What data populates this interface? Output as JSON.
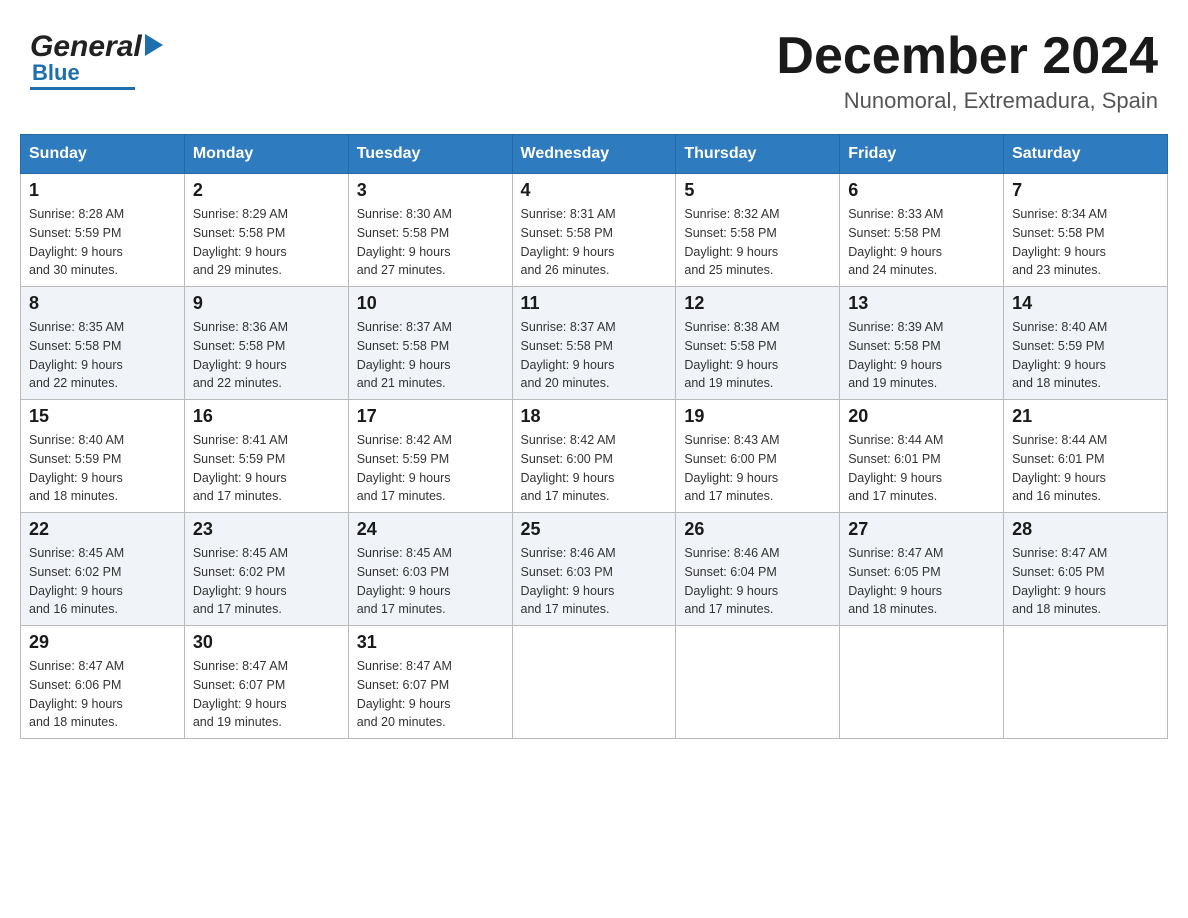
{
  "header": {
    "logo_general": "General",
    "logo_blue": "Blue",
    "month_title": "December 2024",
    "location": "Nunomoral, Extremadura, Spain"
  },
  "columns": [
    "Sunday",
    "Monday",
    "Tuesday",
    "Wednesday",
    "Thursday",
    "Friday",
    "Saturday"
  ],
  "weeks": [
    [
      {
        "day": "1",
        "sunrise": "Sunrise: 8:28 AM",
        "sunset": "Sunset: 5:59 PM",
        "daylight": "Daylight: 9 hours",
        "daylight2": "and 30 minutes."
      },
      {
        "day": "2",
        "sunrise": "Sunrise: 8:29 AM",
        "sunset": "Sunset: 5:58 PM",
        "daylight": "Daylight: 9 hours",
        "daylight2": "and 29 minutes."
      },
      {
        "day": "3",
        "sunrise": "Sunrise: 8:30 AM",
        "sunset": "Sunset: 5:58 PM",
        "daylight": "Daylight: 9 hours",
        "daylight2": "and 27 minutes."
      },
      {
        "day": "4",
        "sunrise": "Sunrise: 8:31 AM",
        "sunset": "Sunset: 5:58 PM",
        "daylight": "Daylight: 9 hours",
        "daylight2": "and 26 minutes."
      },
      {
        "day": "5",
        "sunrise": "Sunrise: 8:32 AM",
        "sunset": "Sunset: 5:58 PM",
        "daylight": "Daylight: 9 hours",
        "daylight2": "and 25 minutes."
      },
      {
        "day": "6",
        "sunrise": "Sunrise: 8:33 AM",
        "sunset": "Sunset: 5:58 PM",
        "daylight": "Daylight: 9 hours",
        "daylight2": "and 24 minutes."
      },
      {
        "day": "7",
        "sunrise": "Sunrise: 8:34 AM",
        "sunset": "Sunset: 5:58 PM",
        "daylight": "Daylight: 9 hours",
        "daylight2": "and 23 minutes."
      }
    ],
    [
      {
        "day": "8",
        "sunrise": "Sunrise: 8:35 AM",
        "sunset": "Sunset: 5:58 PM",
        "daylight": "Daylight: 9 hours",
        "daylight2": "and 22 minutes."
      },
      {
        "day": "9",
        "sunrise": "Sunrise: 8:36 AM",
        "sunset": "Sunset: 5:58 PM",
        "daylight": "Daylight: 9 hours",
        "daylight2": "and 22 minutes."
      },
      {
        "day": "10",
        "sunrise": "Sunrise: 8:37 AM",
        "sunset": "Sunset: 5:58 PM",
        "daylight": "Daylight: 9 hours",
        "daylight2": "and 21 minutes."
      },
      {
        "day": "11",
        "sunrise": "Sunrise: 8:37 AM",
        "sunset": "Sunset: 5:58 PM",
        "daylight": "Daylight: 9 hours",
        "daylight2": "and 20 minutes."
      },
      {
        "day": "12",
        "sunrise": "Sunrise: 8:38 AM",
        "sunset": "Sunset: 5:58 PM",
        "daylight": "Daylight: 9 hours",
        "daylight2": "and 19 minutes."
      },
      {
        "day": "13",
        "sunrise": "Sunrise: 8:39 AM",
        "sunset": "Sunset: 5:58 PM",
        "daylight": "Daylight: 9 hours",
        "daylight2": "and 19 minutes."
      },
      {
        "day": "14",
        "sunrise": "Sunrise: 8:40 AM",
        "sunset": "Sunset: 5:59 PM",
        "daylight": "Daylight: 9 hours",
        "daylight2": "and 18 minutes."
      }
    ],
    [
      {
        "day": "15",
        "sunrise": "Sunrise: 8:40 AM",
        "sunset": "Sunset: 5:59 PM",
        "daylight": "Daylight: 9 hours",
        "daylight2": "and 18 minutes."
      },
      {
        "day": "16",
        "sunrise": "Sunrise: 8:41 AM",
        "sunset": "Sunset: 5:59 PM",
        "daylight": "Daylight: 9 hours",
        "daylight2": "and 17 minutes."
      },
      {
        "day": "17",
        "sunrise": "Sunrise: 8:42 AM",
        "sunset": "Sunset: 5:59 PM",
        "daylight": "Daylight: 9 hours",
        "daylight2": "and 17 minutes."
      },
      {
        "day": "18",
        "sunrise": "Sunrise: 8:42 AM",
        "sunset": "Sunset: 6:00 PM",
        "daylight": "Daylight: 9 hours",
        "daylight2": "and 17 minutes."
      },
      {
        "day": "19",
        "sunrise": "Sunrise: 8:43 AM",
        "sunset": "Sunset: 6:00 PM",
        "daylight": "Daylight: 9 hours",
        "daylight2": "and 17 minutes."
      },
      {
        "day": "20",
        "sunrise": "Sunrise: 8:44 AM",
        "sunset": "Sunset: 6:01 PM",
        "daylight": "Daylight: 9 hours",
        "daylight2": "and 17 minutes."
      },
      {
        "day": "21",
        "sunrise": "Sunrise: 8:44 AM",
        "sunset": "Sunset: 6:01 PM",
        "daylight": "Daylight: 9 hours",
        "daylight2": "and 16 minutes."
      }
    ],
    [
      {
        "day": "22",
        "sunrise": "Sunrise: 8:45 AM",
        "sunset": "Sunset: 6:02 PM",
        "daylight": "Daylight: 9 hours",
        "daylight2": "and 16 minutes."
      },
      {
        "day": "23",
        "sunrise": "Sunrise: 8:45 AM",
        "sunset": "Sunset: 6:02 PM",
        "daylight": "Daylight: 9 hours",
        "daylight2": "and 17 minutes."
      },
      {
        "day": "24",
        "sunrise": "Sunrise: 8:45 AM",
        "sunset": "Sunset: 6:03 PM",
        "daylight": "Daylight: 9 hours",
        "daylight2": "and 17 minutes."
      },
      {
        "day": "25",
        "sunrise": "Sunrise: 8:46 AM",
        "sunset": "Sunset: 6:03 PM",
        "daylight": "Daylight: 9 hours",
        "daylight2": "and 17 minutes."
      },
      {
        "day": "26",
        "sunrise": "Sunrise: 8:46 AM",
        "sunset": "Sunset: 6:04 PM",
        "daylight": "Daylight: 9 hours",
        "daylight2": "and 17 minutes."
      },
      {
        "day": "27",
        "sunrise": "Sunrise: 8:47 AM",
        "sunset": "Sunset: 6:05 PM",
        "daylight": "Daylight: 9 hours",
        "daylight2": "and 18 minutes."
      },
      {
        "day": "28",
        "sunrise": "Sunrise: 8:47 AM",
        "sunset": "Sunset: 6:05 PM",
        "daylight": "Daylight: 9 hours",
        "daylight2": "and 18 minutes."
      }
    ],
    [
      {
        "day": "29",
        "sunrise": "Sunrise: 8:47 AM",
        "sunset": "Sunset: 6:06 PM",
        "daylight": "Daylight: 9 hours",
        "daylight2": "and 18 minutes."
      },
      {
        "day": "30",
        "sunrise": "Sunrise: 8:47 AM",
        "sunset": "Sunset: 6:07 PM",
        "daylight": "Daylight: 9 hours",
        "daylight2": "and 19 minutes."
      },
      {
        "day": "31",
        "sunrise": "Sunrise: 8:47 AM",
        "sunset": "Sunset: 6:07 PM",
        "daylight": "Daylight: 9 hours",
        "daylight2": "and 20 minutes."
      },
      null,
      null,
      null,
      null
    ]
  ]
}
